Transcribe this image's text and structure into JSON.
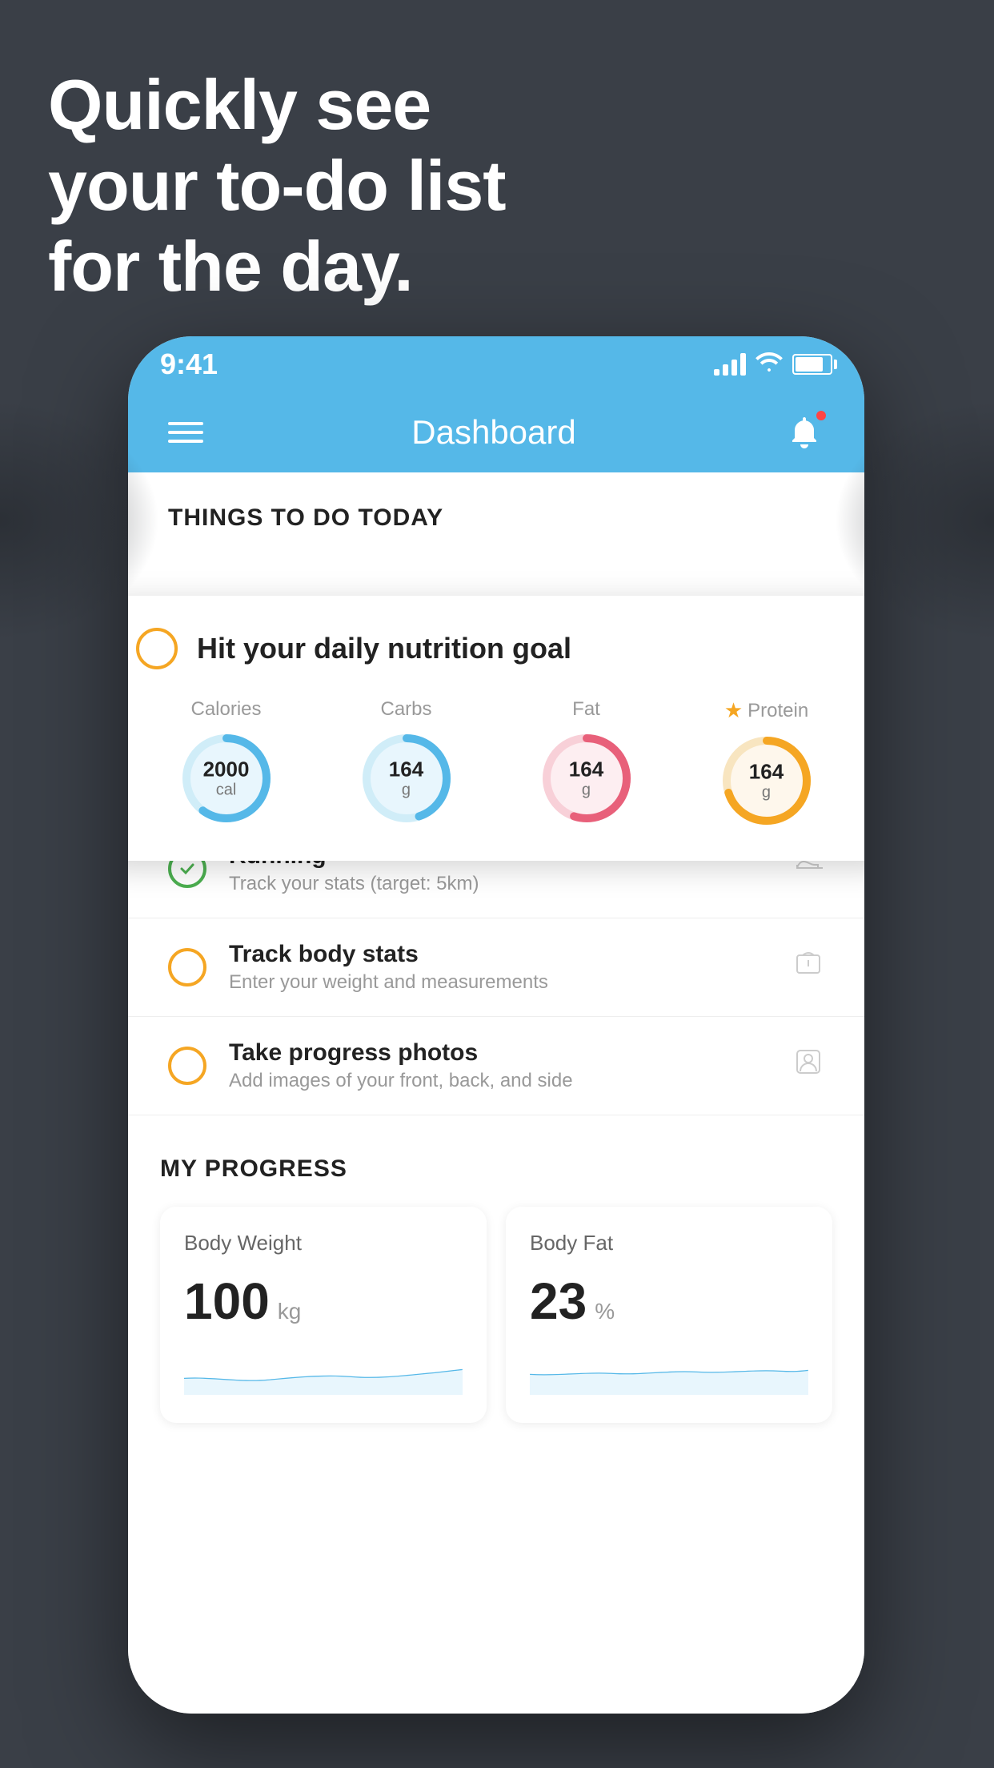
{
  "hero": {
    "line1": "Quickly see",
    "line2": "your to-do list",
    "line3": "for the day."
  },
  "status_bar": {
    "time": "9:41"
  },
  "nav": {
    "title": "Dashboard"
  },
  "things_section": {
    "header": "THINGS TO DO TODAY"
  },
  "nutrition_card": {
    "title": "Hit your daily nutrition goal",
    "items": [
      {
        "label": "Calories",
        "value": "2000",
        "unit": "cal",
        "color": "#55b8e8",
        "bg": "#e8f6fd",
        "percent": 60
      },
      {
        "label": "Carbs",
        "value": "164",
        "unit": "g",
        "color": "#55b8e8",
        "bg": "#e8f6fd",
        "percent": 45
      },
      {
        "label": "Fat",
        "value": "164",
        "unit": "g",
        "color": "#e8607a",
        "bg": "#fdeef1",
        "percent": 55
      },
      {
        "label": "Protein",
        "value": "164",
        "unit": "g",
        "color": "#f5a623",
        "bg": "#fef7ec",
        "percent": 70,
        "star": true
      }
    ]
  },
  "todo_items": [
    {
      "id": "running",
      "title": "Running",
      "subtitle": "Track your stats (target: 5km)",
      "circle_type": "green",
      "icon": "shoe"
    },
    {
      "id": "body-stats",
      "title": "Track body stats",
      "subtitle": "Enter your weight and measurements",
      "circle_type": "yellow",
      "icon": "scale"
    },
    {
      "id": "progress-photos",
      "title": "Take progress photos",
      "subtitle": "Add images of your front, back, and side",
      "circle_type": "yellow",
      "icon": "person"
    }
  ],
  "progress_section": {
    "header": "MY PROGRESS",
    "cards": [
      {
        "title": "Body Weight",
        "value": "100",
        "unit": "kg"
      },
      {
        "title": "Body Fat",
        "value": "23",
        "unit": "%"
      }
    ]
  }
}
